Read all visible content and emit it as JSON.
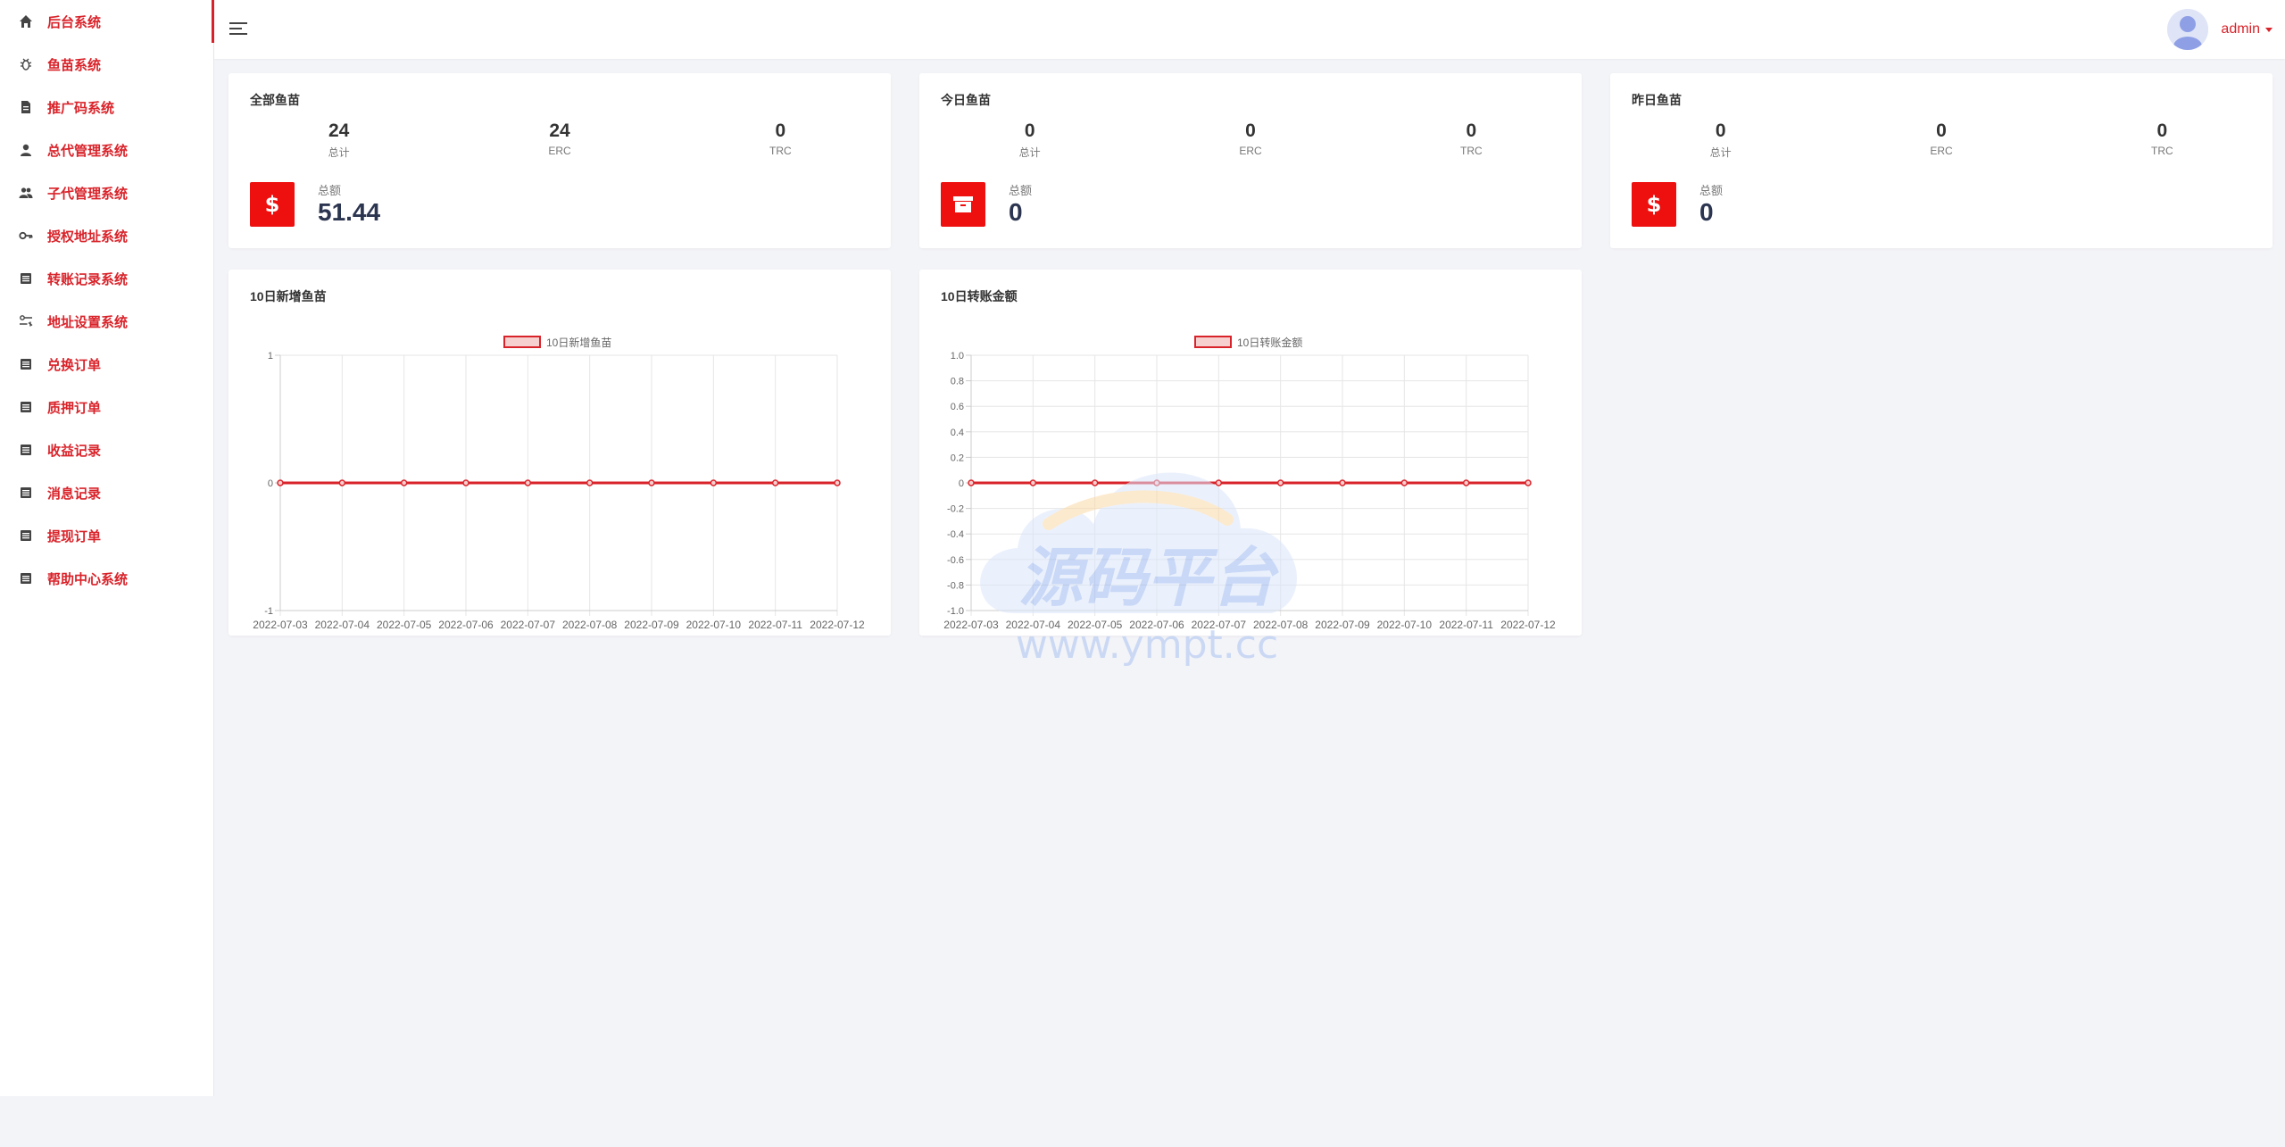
{
  "sidebar": {
    "items": [
      {
        "label": "后台系统",
        "icon": "home-icon"
      },
      {
        "label": "鱼苗系统",
        "icon": "bug-icon"
      },
      {
        "label": "推广码系统",
        "icon": "document-icon"
      },
      {
        "label": "总代管理系统",
        "icon": "person-icon"
      },
      {
        "label": "子代管理系统",
        "icon": "people-icon"
      },
      {
        "label": "授权地址系统",
        "icon": "key-icon"
      },
      {
        "label": "转账记录系统",
        "icon": "list-icon"
      },
      {
        "label": "地址设置系统",
        "icon": "settings-icon"
      },
      {
        "label": "兑换订单",
        "icon": "list-icon"
      },
      {
        "label": "质押订单",
        "icon": "list-icon"
      },
      {
        "label": "收益记录",
        "icon": "list-icon"
      },
      {
        "label": "消息记录",
        "icon": "list-icon"
      },
      {
        "label": "提现订单",
        "icon": "list-icon"
      },
      {
        "label": "帮助中心系统",
        "icon": "list-icon"
      }
    ]
  },
  "header": {
    "username": "admin"
  },
  "stats_cards": [
    {
      "title": "全部鱼苗",
      "stats": [
        {
          "value": "24",
          "label": "总计"
        },
        {
          "value": "24",
          "label": "ERC"
        },
        {
          "value": "0",
          "label": "TRC"
        }
      ],
      "total_label": "总额",
      "total_value": "51.44",
      "icon": "dollar-icon"
    },
    {
      "title": "今日鱼苗",
      "stats": [
        {
          "value": "0",
          "label": "总计"
        },
        {
          "value": "0",
          "label": "ERC"
        },
        {
          "value": "0",
          "label": "TRC"
        }
      ],
      "total_label": "总额",
      "total_value": "0",
      "icon": "archive-icon"
    },
    {
      "title": "昨日鱼苗",
      "stats": [
        {
          "value": "0",
          "label": "总计"
        },
        {
          "value": "0",
          "label": "ERC"
        },
        {
          "value": "0",
          "label": "TRC"
        }
      ],
      "total_label": "总额",
      "total_value": "0",
      "icon": "dollar-icon"
    }
  ],
  "chart_cards": [
    {
      "title": "10日新增鱼苗"
    },
    {
      "title": "10日转账金额"
    }
  ],
  "chart_data": [
    {
      "type": "line",
      "title": "",
      "x": [
        "2022-07-03",
        "2022-07-04",
        "2022-07-05",
        "2022-07-06",
        "2022-07-07",
        "2022-07-08",
        "2022-07-09",
        "2022-07-10",
        "2022-07-11",
        "2022-07-12"
      ],
      "series": [
        {
          "name": "10日新增鱼苗",
          "values": [
            0,
            0,
            0,
            0,
            0,
            0,
            0,
            0,
            0,
            0
          ]
        }
      ],
      "ylim": [
        -1,
        1
      ],
      "yticks": [
        "1",
        "0",
        "-1"
      ],
      "grid": true,
      "legend": "top-center",
      "color": "#d9232a"
    },
    {
      "type": "line",
      "title": "",
      "x": [
        "2022-07-03",
        "2022-07-04",
        "2022-07-05",
        "2022-07-06",
        "2022-07-07",
        "2022-07-08",
        "2022-07-09",
        "2022-07-10",
        "2022-07-11",
        "2022-07-12"
      ],
      "series": [
        {
          "name": "10日转账金额",
          "values": [
            0,
            0,
            0,
            0,
            0,
            0,
            0,
            0,
            0,
            0
          ]
        }
      ],
      "ylim": [
        -1.0,
        1.0
      ],
      "yticks": [
        "1.0",
        "0.8",
        "0.6",
        "0.4",
        "0.2",
        "0",
        "-0.2",
        "-0.4",
        "-0.6",
        "-0.8",
        "-1.0"
      ],
      "grid": true,
      "legend": "top-center",
      "color": "#d9232a"
    }
  ],
  "watermark": {
    "line1": "源码平台",
    "line2": "www.ympt.cc"
  },
  "colors": {
    "accent": "#d9232a",
    "icon_box": "#ee0f0f",
    "background": "#f3f4f8"
  }
}
